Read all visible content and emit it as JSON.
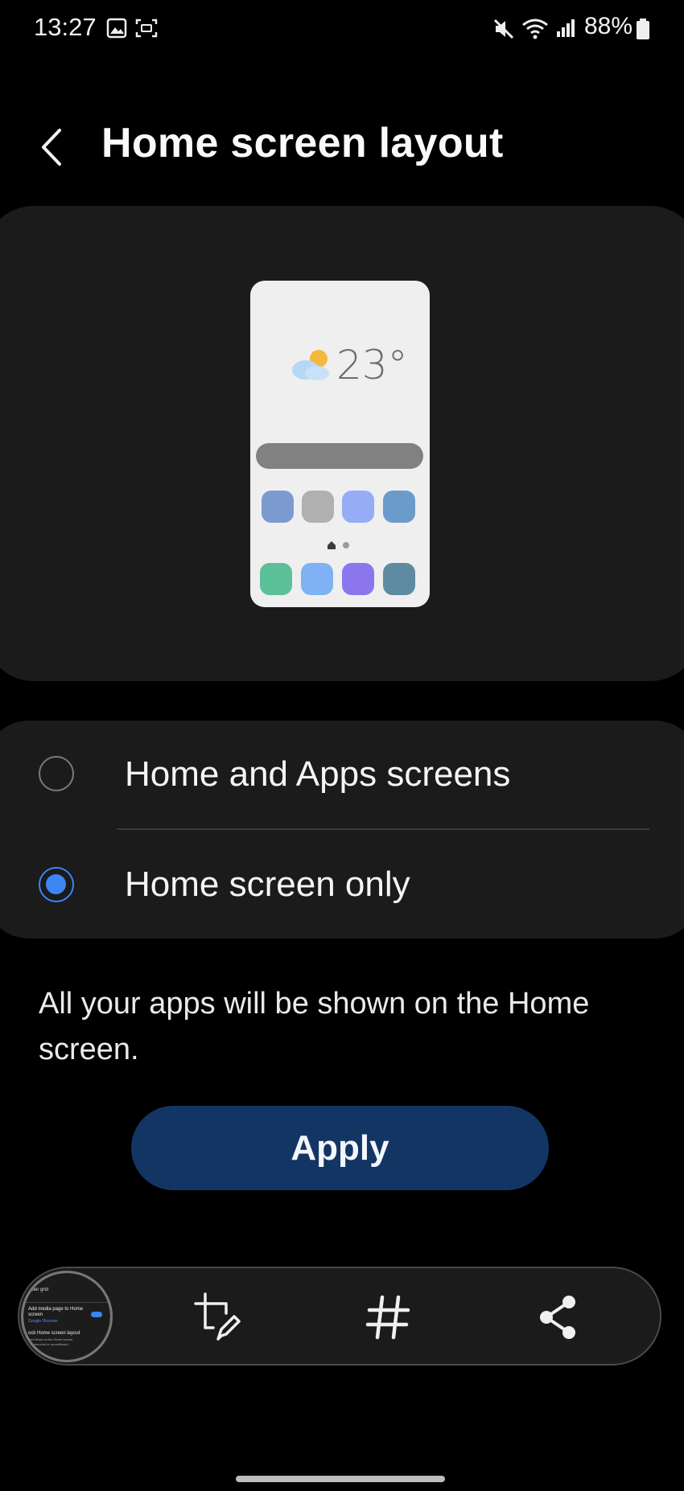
{
  "status_bar": {
    "time": "13:27",
    "battery": "88%",
    "icons": [
      "gallery-icon",
      "screen-record-icon",
      "mute-icon",
      "wifi-icon",
      "signal-icon",
      "battery-icon"
    ]
  },
  "header": {
    "title": "Home screen layout",
    "back_icon": "chevron-left-icon"
  },
  "preview": {
    "weather_temp": "23°",
    "app_icon_colors_row1": [
      "#7b9bd0",
      "#b0b0b0",
      "#95acf7",
      "#6b9bcb"
    ],
    "app_icon_colors_row2": [
      "#5cc198",
      "#7fb2f5",
      "#8c76ee",
      "#5e8ba2"
    ]
  },
  "options": {
    "items": [
      {
        "label": "Home and Apps screens",
        "selected": false
      },
      {
        "label": "Home screen only",
        "selected": true
      }
    ]
  },
  "description": "All your apps will be shown on the Home screen.",
  "apply_label": "Apply",
  "toolbar": {
    "thumbnail_lines": [
      "older grid",
      "Add media page to Home screen",
      "Google Discover",
      "ock Home screen layout",
      "vent items on the Home screen",
      "ing removed or repositioned."
    ],
    "buttons": [
      "crop-edit-icon",
      "hashtag-icon",
      "share-icon"
    ]
  },
  "colors": {
    "accent": "#3b86f2",
    "apply_bg": "#133564",
    "card_bg": "#1b1b1b"
  }
}
